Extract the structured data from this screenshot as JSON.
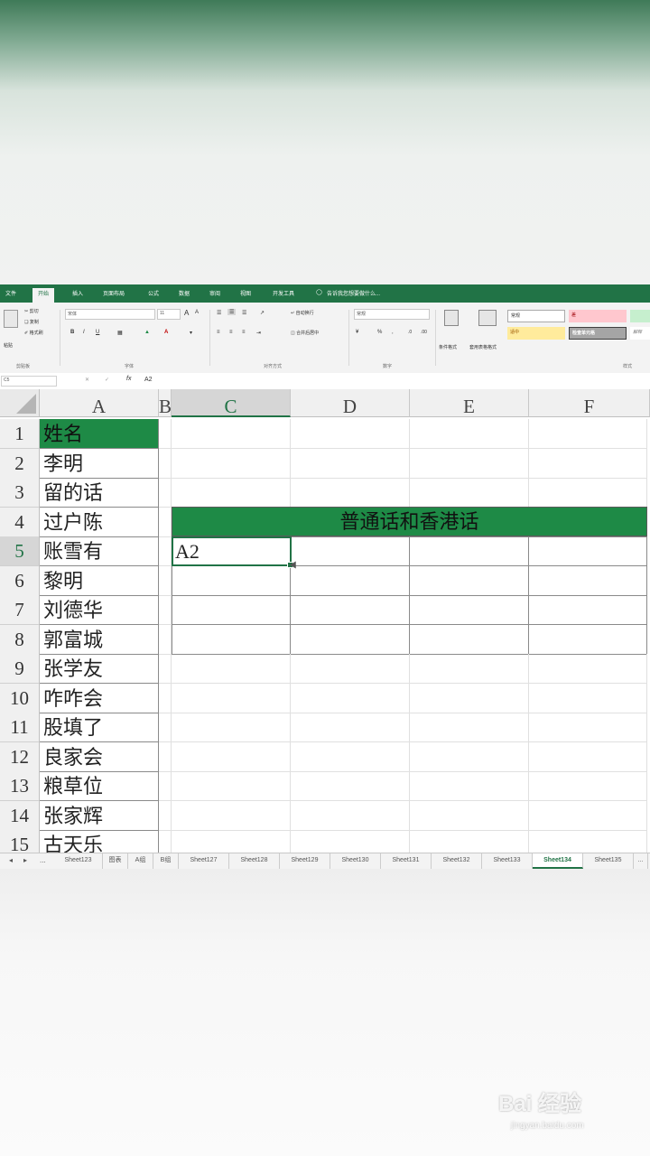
{
  "menu": {
    "items": [
      "文件",
      "开始",
      "插入",
      "页面布局",
      "公式",
      "数据",
      "审阅",
      "视图",
      "开发工具"
    ],
    "active_index": 1,
    "tell_me": "告诉我您想要做什么..."
  },
  "ribbon": {
    "clipboard": {
      "paste": "粘贴",
      "cut": "剪切",
      "copy": "复制",
      "format_painter": "格式刷",
      "group_label": "剪贴板"
    },
    "font": {
      "name": "宋体",
      "size": "11",
      "bold": "B",
      "italic": "I",
      "underline": "U",
      "grow": "A",
      "shrink": "A",
      "group_label": "字体"
    },
    "alignment": {
      "wrap": "自动换行",
      "merge": "合并后居中",
      "group_label": "对齐方式"
    },
    "number": {
      "format": "常规",
      "group_label": "数字"
    },
    "styles": {
      "conditional": "条件格式",
      "table_format": "套用表格格式",
      "normal": "常规",
      "bad": "差",
      "neutral": "适中",
      "calc": "检查单元格",
      "explain": "解释",
      "group_label": "样式"
    }
  },
  "formula_bar": {
    "name_box": "C5",
    "fx": "fx",
    "content": "A2"
  },
  "grid": {
    "columns": [
      "A",
      "B",
      "C",
      "D",
      "E",
      "F"
    ],
    "selected_column": "C",
    "rows": [
      "1",
      "2",
      "3",
      "4",
      "5",
      "6",
      "7",
      "8",
      "9",
      "10",
      "11",
      "12",
      "13",
      "14",
      "15"
    ],
    "selected_row": "5",
    "column_a": [
      "姓名",
      "李明",
      "留的话",
      "过户陈",
      "账雪有",
      "黎明",
      "刘德华",
      "郭富城",
      "张学友",
      "咋咋会",
      "股填了",
      "良家会",
      "粮草位",
      "张家辉",
      "古天乐"
    ],
    "merged_title": "普通话和香港话",
    "c5_value": "A2"
  },
  "sheet_tabs": {
    "nav": [
      "◂",
      "▸",
      "..."
    ],
    "tabs": [
      "Sheet123",
      "图表",
      "A组",
      "B组",
      "Sheet127",
      "Sheet128",
      "Sheet129",
      "Sheet130",
      "Sheet131",
      "Sheet132",
      "Sheet133",
      "Sheet134",
      "Sheet135",
      "..."
    ],
    "active": "Sheet134"
  },
  "watermark": {
    "main": "Bai 经验",
    "sub": "jingyan.baidu.com"
  },
  "colors": {
    "excel_green": "#217346",
    "header_fill": "#1e8a46"
  }
}
